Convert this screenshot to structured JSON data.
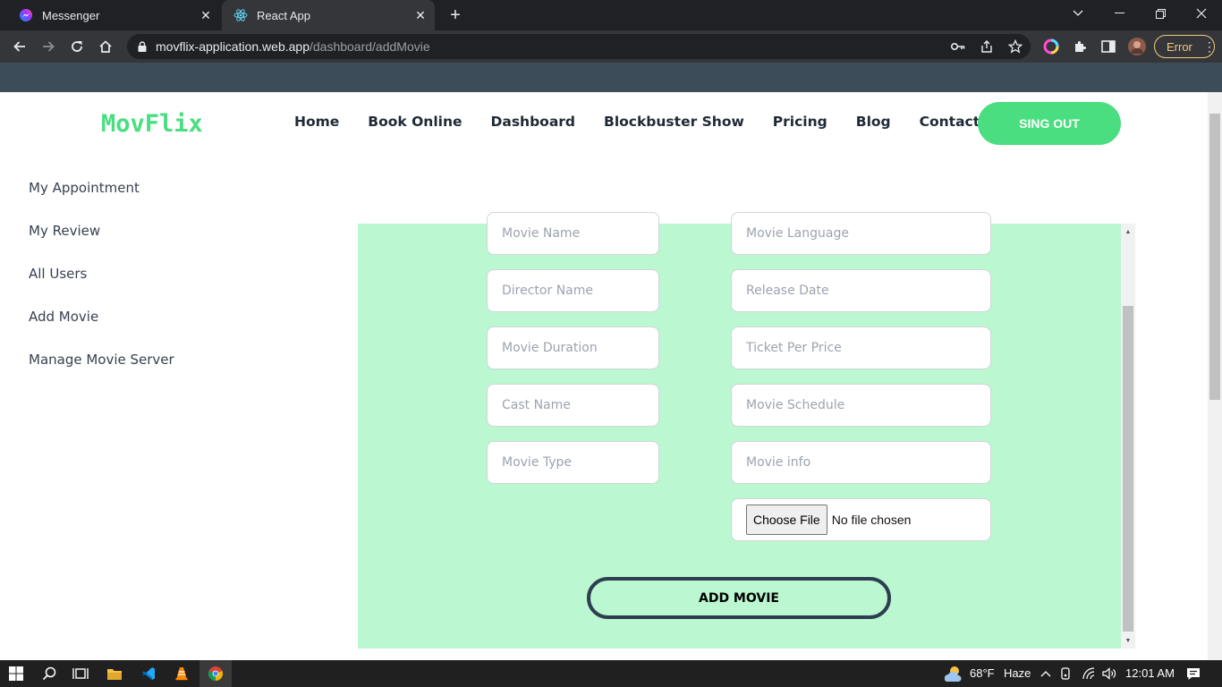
{
  "browser": {
    "tabs": [
      {
        "title": "Messenger",
        "favicon": "messenger-icon"
      },
      {
        "title": "React App",
        "favicon": "react-icon"
      }
    ],
    "url_host": "movflix-application.web.app",
    "url_path": "/dashboard/addMovie",
    "error_label": "Error",
    "icons": [
      "back-icon",
      "forward-icon",
      "reload-icon",
      "home-icon",
      "lock-icon",
      "key-icon",
      "share-icon",
      "star-icon",
      "extension-icon",
      "sidepanel-icon",
      "profile-avatar"
    ]
  },
  "header": {
    "brand": "MovFlix",
    "nav": [
      "Home",
      "Book Online",
      "Dashboard",
      "Blockbuster Show",
      "Pricing",
      "Blog",
      "Contact"
    ],
    "signout_label": "SING OUT"
  },
  "sidebar": {
    "items": [
      "My Appointment",
      "My Review",
      "All Users",
      "Add Movie",
      "Manage Movie Server"
    ]
  },
  "form": {
    "left_placeholders": [
      "Movie Name",
      "Director Name",
      "Movie Duration",
      "Cast Name",
      "Movie Type"
    ],
    "right_placeholders": [
      "Movie Language",
      "Release Date",
      "Ticket Per Price",
      "Movie Schedule",
      "Movie info"
    ],
    "file_button": "Choose File",
    "file_status": "No file chosen",
    "submit_label": "ADD MOVIE"
  },
  "taskbar": {
    "weather": "68°F",
    "condition": "Haze",
    "time": "12:01 AM"
  },
  "colors": {
    "accent": "#4ade80",
    "panel": "#bbf7d0",
    "button_border": "#2c3e50"
  }
}
